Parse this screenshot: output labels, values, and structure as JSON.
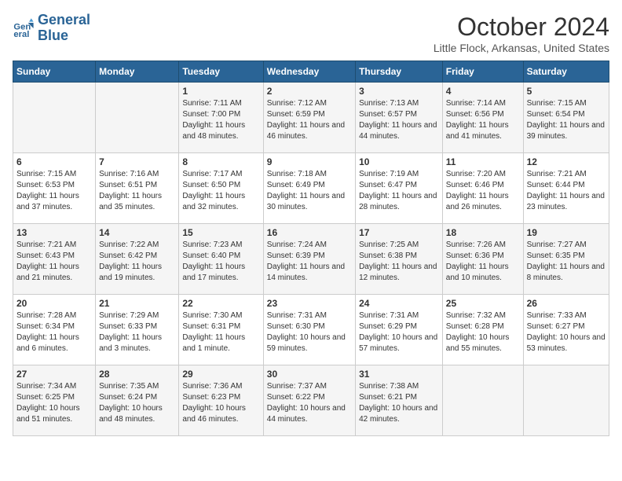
{
  "header": {
    "logo_line1": "General",
    "logo_line2": "Blue",
    "month": "October 2024",
    "location": "Little Flock, Arkansas, United States"
  },
  "days_of_week": [
    "Sunday",
    "Monday",
    "Tuesday",
    "Wednesday",
    "Thursday",
    "Friday",
    "Saturday"
  ],
  "weeks": [
    [
      {
        "day": "",
        "info": ""
      },
      {
        "day": "",
        "info": ""
      },
      {
        "day": "1",
        "info": "Sunrise: 7:11 AM\nSunset: 7:00 PM\nDaylight: 11 hours and 48 minutes."
      },
      {
        "day": "2",
        "info": "Sunrise: 7:12 AM\nSunset: 6:59 PM\nDaylight: 11 hours and 46 minutes."
      },
      {
        "day": "3",
        "info": "Sunrise: 7:13 AM\nSunset: 6:57 PM\nDaylight: 11 hours and 44 minutes."
      },
      {
        "day": "4",
        "info": "Sunrise: 7:14 AM\nSunset: 6:56 PM\nDaylight: 11 hours and 41 minutes."
      },
      {
        "day": "5",
        "info": "Sunrise: 7:15 AM\nSunset: 6:54 PM\nDaylight: 11 hours and 39 minutes."
      }
    ],
    [
      {
        "day": "6",
        "info": "Sunrise: 7:15 AM\nSunset: 6:53 PM\nDaylight: 11 hours and 37 minutes."
      },
      {
        "day": "7",
        "info": "Sunrise: 7:16 AM\nSunset: 6:51 PM\nDaylight: 11 hours and 35 minutes."
      },
      {
        "day": "8",
        "info": "Sunrise: 7:17 AM\nSunset: 6:50 PM\nDaylight: 11 hours and 32 minutes."
      },
      {
        "day": "9",
        "info": "Sunrise: 7:18 AM\nSunset: 6:49 PM\nDaylight: 11 hours and 30 minutes."
      },
      {
        "day": "10",
        "info": "Sunrise: 7:19 AM\nSunset: 6:47 PM\nDaylight: 11 hours and 28 minutes."
      },
      {
        "day": "11",
        "info": "Sunrise: 7:20 AM\nSunset: 6:46 PM\nDaylight: 11 hours and 26 minutes."
      },
      {
        "day": "12",
        "info": "Sunrise: 7:21 AM\nSunset: 6:44 PM\nDaylight: 11 hours and 23 minutes."
      }
    ],
    [
      {
        "day": "13",
        "info": "Sunrise: 7:21 AM\nSunset: 6:43 PM\nDaylight: 11 hours and 21 minutes."
      },
      {
        "day": "14",
        "info": "Sunrise: 7:22 AM\nSunset: 6:42 PM\nDaylight: 11 hours and 19 minutes."
      },
      {
        "day": "15",
        "info": "Sunrise: 7:23 AM\nSunset: 6:40 PM\nDaylight: 11 hours and 17 minutes."
      },
      {
        "day": "16",
        "info": "Sunrise: 7:24 AM\nSunset: 6:39 PM\nDaylight: 11 hours and 14 minutes."
      },
      {
        "day": "17",
        "info": "Sunrise: 7:25 AM\nSunset: 6:38 PM\nDaylight: 11 hours and 12 minutes."
      },
      {
        "day": "18",
        "info": "Sunrise: 7:26 AM\nSunset: 6:36 PM\nDaylight: 11 hours and 10 minutes."
      },
      {
        "day": "19",
        "info": "Sunrise: 7:27 AM\nSunset: 6:35 PM\nDaylight: 11 hours and 8 minutes."
      }
    ],
    [
      {
        "day": "20",
        "info": "Sunrise: 7:28 AM\nSunset: 6:34 PM\nDaylight: 11 hours and 6 minutes."
      },
      {
        "day": "21",
        "info": "Sunrise: 7:29 AM\nSunset: 6:33 PM\nDaylight: 11 hours and 3 minutes."
      },
      {
        "day": "22",
        "info": "Sunrise: 7:30 AM\nSunset: 6:31 PM\nDaylight: 11 hours and 1 minute."
      },
      {
        "day": "23",
        "info": "Sunrise: 7:31 AM\nSunset: 6:30 PM\nDaylight: 10 hours and 59 minutes."
      },
      {
        "day": "24",
        "info": "Sunrise: 7:31 AM\nSunset: 6:29 PM\nDaylight: 10 hours and 57 minutes."
      },
      {
        "day": "25",
        "info": "Sunrise: 7:32 AM\nSunset: 6:28 PM\nDaylight: 10 hours and 55 minutes."
      },
      {
        "day": "26",
        "info": "Sunrise: 7:33 AM\nSunset: 6:27 PM\nDaylight: 10 hours and 53 minutes."
      }
    ],
    [
      {
        "day": "27",
        "info": "Sunrise: 7:34 AM\nSunset: 6:25 PM\nDaylight: 10 hours and 51 minutes."
      },
      {
        "day": "28",
        "info": "Sunrise: 7:35 AM\nSunset: 6:24 PM\nDaylight: 10 hours and 48 minutes."
      },
      {
        "day": "29",
        "info": "Sunrise: 7:36 AM\nSunset: 6:23 PM\nDaylight: 10 hours and 46 minutes."
      },
      {
        "day": "30",
        "info": "Sunrise: 7:37 AM\nSunset: 6:22 PM\nDaylight: 10 hours and 44 minutes."
      },
      {
        "day": "31",
        "info": "Sunrise: 7:38 AM\nSunset: 6:21 PM\nDaylight: 10 hours and 42 minutes."
      },
      {
        "day": "",
        "info": ""
      },
      {
        "day": "",
        "info": ""
      }
    ]
  ]
}
